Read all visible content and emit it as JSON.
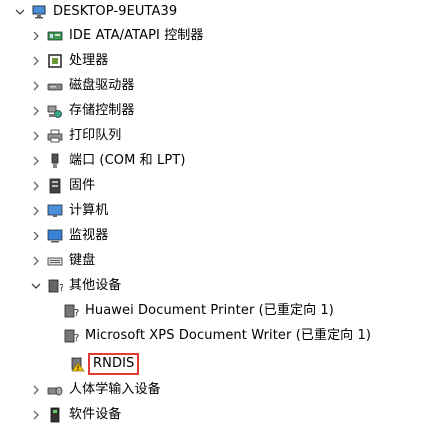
{
  "tree": {
    "root": {
      "label": "DESKTOP-9EUTA39",
      "icon": "computer-icon"
    },
    "categories": [
      {
        "label": "IDE ATA/ATAPI 控制器",
        "icon": "ide-controller-icon"
      },
      {
        "label": "处理器",
        "icon": "processor-icon"
      },
      {
        "label": "磁盘驱动器",
        "icon": "disk-drive-icon"
      },
      {
        "label": "存储控制器",
        "icon": "storage-controller-icon"
      },
      {
        "label": "打印队列",
        "icon": "printer-icon"
      },
      {
        "label": "端口 (COM 和 LPT)",
        "icon": "port-icon"
      },
      {
        "label": "固件",
        "icon": "firmware-icon"
      },
      {
        "label": "计算机",
        "icon": "computer-icon"
      },
      {
        "label": "监视器",
        "icon": "monitor-icon"
      },
      {
        "label": "键盘",
        "icon": "keyboard-icon"
      },
      {
        "label": "其他设备",
        "icon": "unknown-device-icon",
        "expanded": true
      },
      {
        "label": "人体学输入设备",
        "icon": "hid-icon"
      },
      {
        "label": "软件设备",
        "icon": "software-device-icon"
      }
    ],
    "other_devices": [
      {
        "label": "Huawei Document Printer (已重定向 1)",
        "icon": "unknown-device-icon"
      },
      {
        "label": "Microsoft XPS Document Writer (已重定向 1)",
        "icon": "unknown-device-icon"
      },
      {
        "label": "RNDIS",
        "icon": "warning-device-icon",
        "highlighted": true
      }
    ]
  },
  "colors": {
    "highlight_border": "#e53935",
    "chevron": "#555555"
  }
}
